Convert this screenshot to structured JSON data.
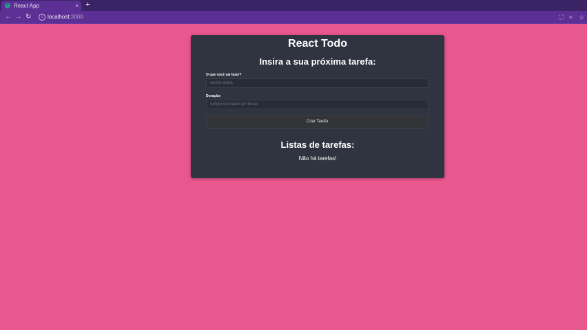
{
  "browser": {
    "tab_title": "React App",
    "tab_close": "×",
    "new_tab": "+",
    "url_host": "localhost",
    "url_port": ":3000",
    "icons": {
      "back": "arrow-left-icon",
      "forward": "arrow-right-icon",
      "reload": "reload-icon",
      "site_info": "info-icon",
      "translate": "translate-icon",
      "share": "share-icon",
      "bookmark": "star-icon"
    }
  },
  "app": {
    "title": "React Todo",
    "form_heading": "Insira a sua próxima tarefa:",
    "task_label": "O que você vai fazer?",
    "task_placeholder": "Tarefa tarefa",
    "duration_label": "Duração:",
    "duration_placeholder": "Tempo estimado em horas",
    "create_button": "Criar Tarefa",
    "list_heading": "Listas de tarefas:",
    "empty_message": "Não há tarefas!"
  },
  "colors": {
    "page_background": "#e9578f",
    "card_background": "#2f3440",
    "browser_frame": "#5b2f93"
  }
}
